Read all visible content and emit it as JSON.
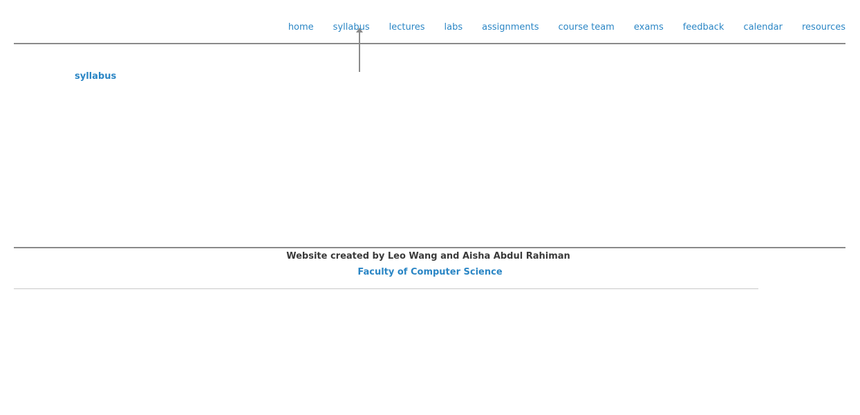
{
  "nav": {
    "items": [
      {
        "label": "home"
      },
      {
        "label": "syllabus"
      },
      {
        "label": "lectures"
      },
      {
        "label": "labs"
      },
      {
        "label": "assignments"
      },
      {
        "label": "course team"
      },
      {
        "label": "exams"
      },
      {
        "label": "feedback"
      },
      {
        "label": "calendar"
      },
      {
        "label": "resources"
      }
    ]
  },
  "main": {
    "current_page_label": "syllabus"
  },
  "footer": {
    "credit": "Website created by Leo Wang and Aisha Abdul Rahiman",
    "faculty_link": "Faculty of Computer Science"
  },
  "colors": {
    "link": "#2b86c5",
    "text": "#3a3a3a",
    "rule": "#8a8a8a"
  }
}
